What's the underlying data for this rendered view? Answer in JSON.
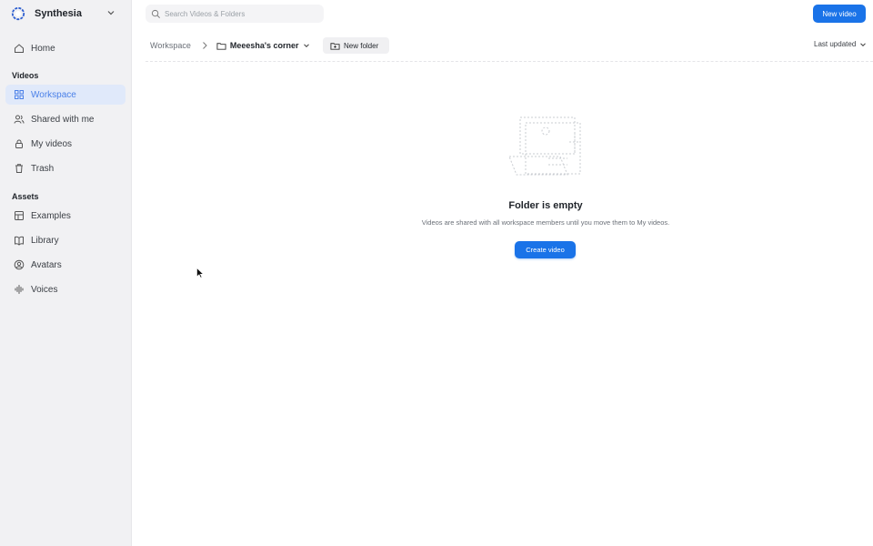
{
  "app": {
    "brand_name": "Synthesia"
  },
  "sidebar": {
    "home": {
      "label": "Home",
      "icon": "home-icon"
    },
    "videos_section": "Videos",
    "videos_items": [
      {
        "label": "Workspace",
        "icon": "grid-icon",
        "active": true
      },
      {
        "label": "Shared with me",
        "icon": "users-icon",
        "active": false
      },
      {
        "label": "My videos",
        "icon": "lock-icon",
        "active": false
      },
      {
        "label": "Trash",
        "icon": "trash-icon",
        "active": false
      }
    ],
    "assets_section": "Assets",
    "assets_items": [
      {
        "label": "Examples",
        "icon": "layout-icon"
      },
      {
        "label": "Library",
        "icon": "book-icon"
      },
      {
        "label": "Avatars",
        "icon": "avatar-icon"
      },
      {
        "label": "Voices",
        "icon": "waveform-icon"
      }
    ]
  },
  "topbar": {
    "search_placeholder": "Search Videos & Folders",
    "new_video_label": "New video"
  },
  "breadcrumb": {
    "root": "Workspace",
    "current": "Meeesha's corner",
    "new_folder_label": "New folder",
    "sort_label": "Last updated"
  },
  "empty_state": {
    "title": "Folder is empty",
    "description": "Videos are shared with all workspace members until you move them to My videos.",
    "button_label": "Create video"
  },
  "colors": {
    "accent": "#1a73e8",
    "active_nav_bg": "#e0e9fa",
    "sidebar_bg": "#f1f1f3"
  }
}
